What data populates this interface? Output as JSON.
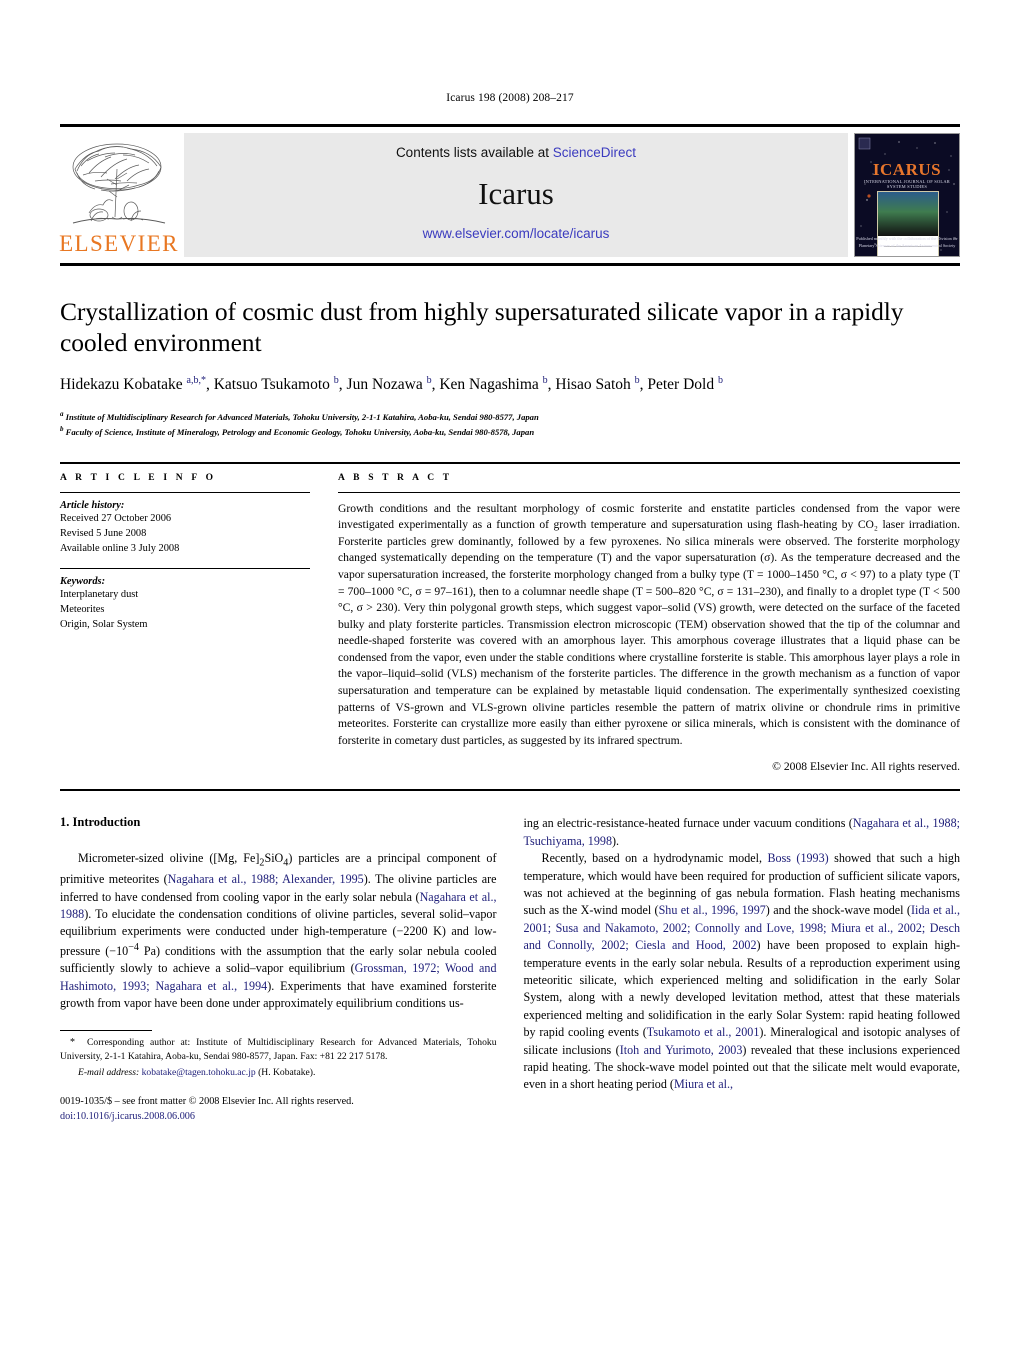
{
  "running_head": "Icarus 198 (2008) 208–217",
  "masthead": {
    "publisher_logo_name": "elsevier-tree-logo",
    "publisher_wordmark": "ELSEVIER",
    "contents_prefix": "Contents lists available at ",
    "contents_link": "ScienceDirect",
    "journal_name": "Icarus",
    "journal_url": "www.elsevier.com/locate/icarus",
    "cover": {
      "title": "ICARUS",
      "subtitle": "INTERNATIONAL JOURNAL OF SOLAR SYSTEM STUDIES",
      "footer": "Published monthly with the collaboration of the Division for Planetary Sciences of the American Astronomical Society"
    }
  },
  "article": {
    "title": "Crystallization of cosmic dust from highly supersaturated silicate vapor in a rapidly cooled environment",
    "authors_html": "Hidekazu Kobatake <sup>a,b,</sup><sup>*</sup>, Katsuo Tsukamoto <sup>b</sup>, Jun Nozawa <sup>b</sup>, Ken Nagashima <sup>b</sup>, Hisao Satoh <sup>b</sup>, Peter Dold <sup>b</sup>",
    "affiliations": [
      {
        "marker": "a",
        "text": "Institute of Multidisciplinary Research for Advanced Materials, Tohoku University, 2-1-1 Katahira, Aoba-ku, Sendai 980-8577, Japan"
      },
      {
        "marker": "b",
        "text": "Faculty of Science, Institute of Mineralogy, Petrology and Economic Geology, Tohoku University, Aoba-ku, Sendai 980-8578, Japan"
      }
    ]
  },
  "article_info": {
    "heading": "A R T I C L E    I N F O",
    "history_title": "Article history:",
    "history": [
      "Received 27 October 2006",
      "Revised 5 June 2008",
      "Available online 3 July 2008"
    ],
    "keywords_title": "Keywords:",
    "keywords": [
      "Interplanetary dust",
      "Meteorites",
      "Origin, Solar System"
    ]
  },
  "abstract": {
    "heading": "A B S T R A C T",
    "text": "Growth conditions and the resultant morphology of cosmic forsterite and enstatite particles condensed from the vapor were investigated experimentally as a function of growth temperature and supersaturation using flash-heating by CO₂ laser irradiation. Forsterite particles grew dominantly, followed by a few pyroxenes. No silica minerals were observed. The forsterite morphology changed systematically depending on the temperature (T) and the vapor supersaturation (σ). As the temperature decreased and the vapor supersaturation increased, the forsterite morphology changed from a bulky type (T = 1000–1450 °C, σ < 97) to a platy type (T = 700–1000 °C, σ = 97–161), then to a columnar needle shape (T = 500–820 °C, σ = 131–230), and finally to a droplet type (T < 500 °C, σ > 230). Very thin polygonal growth steps, which suggest vapor–solid (VS) growth, were detected on the surface of the faceted bulky and platy forsterite particles. Transmission electron microscopic (TEM) observation showed that the tip of the columnar and needle-shaped forsterite was covered with an amorphous layer. This amorphous coverage illustrates that a liquid phase can be condensed from the vapor, even under the stable conditions where crystalline forsterite is stable. This amorphous layer plays a role in the vapor–liquid–solid (VLS) mechanism of the forsterite particles. The difference in the growth mechanism as a function of vapor supersaturation and temperature can be explained by metastable liquid condensation. The experimentally synthesized coexisting patterns of VS-grown and VLS-grown olivine particles resemble the pattern of matrix olivine or chondrule rims in primitive meteorites. Forsterite can crystallize more easily than either pyroxene or silica minerals, which is consistent with the dominance of forsterite in cometary dust particles, as suggested by its infrared spectrum.",
    "copyright": "© 2008 Elsevier Inc. All rights reserved."
  },
  "body": {
    "section_heading": "1. Introduction",
    "left_paragraph_html": "Micrometer-sized olivine ([Mg, Fe]<sub>2</sub>SiO<sub>4</sub>) particles are a principal component of primitive meteorites (<span class=\"ref\">Nagahara et al., 1988; Alexander, 1995</span>). The olivine particles are inferred to have condensed from cooling vapor in the early solar nebula (<span class=\"ref\">Nagahara et al., 1988</span>). To elucidate the condensation conditions of olivine particles, several solid–vapor equilibrium experiments were conducted under high-temperature (−2200 K) and low-pressure (−10<sup>−4</sup> Pa) conditions with the assumption that the early solar nebula cooled sufficiently slowly to achieve a solid–vapor equilibrium (<span class=\"ref\">Grossman, 1972; Wood and Hashimoto, 1993; Nagahara et al., 1994</span>). Experiments that have examined forsterite growth from vapor have been done under approximately equilibrium conditions us-",
    "right_paragraph_1_html": "ing an electric-resistance-heated furnace under vacuum conditions (<span class=\"ref\">Nagahara et al., 1988; Tsuchiyama, 1998</span>).",
    "right_paragraph_2_html": "Recently, based on a hydrodynamic model, <span class=\"ref\">Boss (1993)</span> showed that such a high temperature, which would have been required for production of sufficient silicate vapors, was not achieved at the beginning of gas nebula formation. Flash heating mechanisms such as the X-wind model (<span class=\"ref\">Shu et al., 1996, 1997</span>) and the shock-wave model (<span class=\"ref\">Iida et al., 2001; Susa and Nakamoto, 2002; Connolly and Love, 1998; Miura et al., 2002; Desch and Connolly, 2002; Ciesla and Hood, 2002</span>) have been proposed to explain high-temperature events in the early solar nebula. Results of a reproduction experiment using meteoritic silicate, which experienced melting and solidification in the early Solar System, along with a newly developed levitation method, attest that these materials experienced melting and solidification in the early Solar System: rapid heating followed by rapid cooling events (<span class=\"ref\">Tsukamoto et al., 2001</span>). Mineralogical and isotopic analyses of silicate inclusions (<span class=\"ref\">Itoh and Yurimoto, 2003</span>) revealed that these inclusions experienced rapid heating. The shock-wave model pointed out that the silicate melt would evaporate, even in a short heating period (<span class=\"ref\">Miura et al.,</span>"
  },
  "footnotes": {
    "corresponding_html": "<span class=\"star\">*</span>&nbsp; Corresponding author at: Institute of Multidisciplinary Research for Advanced Materials, Tohoku University, 2-1-1 Katahira, Aoba-ku, Sendai 980-8577, Japan. Fax: +81 22 217 5178.",
    "email_label": "E-mail address:",
    "email": "kobatake@tagen.tohoku.ac.jp",
    "email_owner": "(H. Kobatake).",
    "issn_line": "0019-1035/$ – see front matter  © 2008 Elsevier Inc. All rights reserved.",
    "doi": "doi:10.1016/j.icarus.2008.06.006"
  },
  "colors": {
    "elsevier_orange": "#E87722",
    "link_blue": "#3b3bbf",
    "reference_blue": "#20207a",
    "band_gray": "#e9e9e9"
  }
}
